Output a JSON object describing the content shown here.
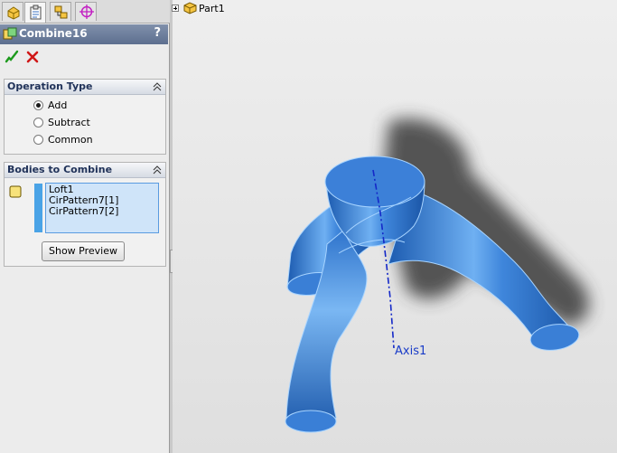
{
  "feature": {
    "title": "Combine16",
    "help": "?"
  },
  "tabs": [
    {
      "name": "feature-manager"
    },
    {
      "name": "property-manager"
    },
    {
      "name": "configuration-manager"
    },
    {
      "name": "dimxpert-manager"
    }
  ],
  "operation_type": {
    "header": "Operation Type",
    "options": [
      "Add",
      "Subtract",
      "Common"
    ],
    "selected": "Add"
  },
  "bodies": {
    "header": "Bodies to Combine",
    "items": [
      "Loft1",
      "CirPattern7[1]",
      "CirPattern7[2]"
    ],
    "preview_button": "Show Preview"
  },
  "tree": {
    "part_label": "Part1"
  },
  "viewport": {
    "axis_label": "Axis1"
  },
  "colors": {
    "body": "#4a8fe0",
    "body_dark": "#1f5fb4",
    "edge": "#9fd0ff",
    "title_bar": "#6d7f9d",
    "group_header_text": "#1f3158"
  }
}
